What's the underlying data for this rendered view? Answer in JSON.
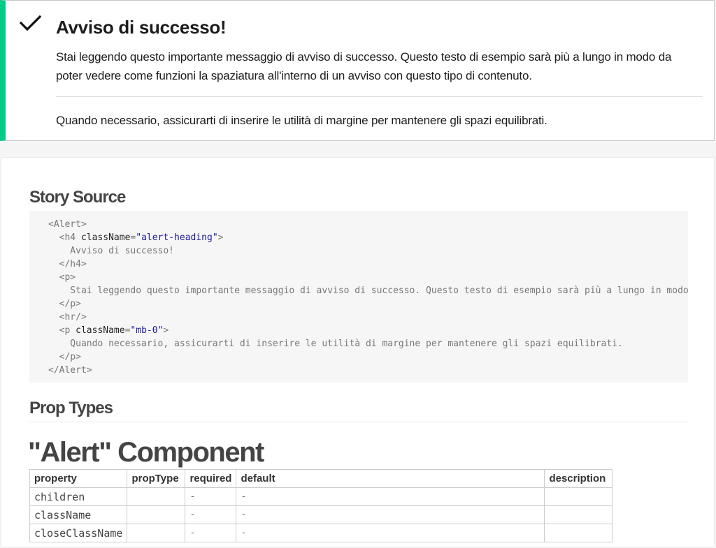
{
  "alert": {
    "icon": "check-icon",
    "heading": "Avviso di successo!",
    "body": "Stai leggendo questo importante messaggio di avviso di successo. Questo testo di esempio sarà più a lungo in modo da poter vedere come funzioni la spaziatura all'interno di un avviso con questo tipo di contenuto.",
    "footer": "Quando necessario, assicurarti di inserire le utilità di margine per mantenere gli spazi equilibrati.",
    "accent_color": "#00cc85"
  },
  "story_source": {
    "title": "Story Source",
    "lines": [
      "<Alert>",
      "  <h4 className=\"alert-heading\">",
      "    Avviso di successo!",
      "  </h4>",
      "  <p>",
      "    Stai leggendo questo importante messaggio di avviso di successo. Questo testo di esempio sarà più a lungo in modo da poter vedere come funzioni la spaziatura all'interno di un avviso con questo tipo di contenuto.",
      "  </p>",
      "  <hr/>",
      "  <p className=\"mb-0\">",
      "    Quando necessario, assicurarti di inserire le utilità di margine per mantenere gli spazi equilibrati.",
      "  </p>",
      "</Alert>"
    ]
  },
  "prop_types": {
    "title": "Prop Types",
    "component_title": "\"Alert\" Component",
    "columns": [
      "property",
      "propType",
      "required",
      "default",
      "description"
    ],
    "rows": [
      [
        "children",
        "",
        "-",
        "-",
        ""
      ],
      [
        "className",
        "",
        "-",
        "-",
        ""
      ],
      [
        "closeClassName",
        "",
        "-",
        "-",
        ""
      ]
    ]
  }
}
